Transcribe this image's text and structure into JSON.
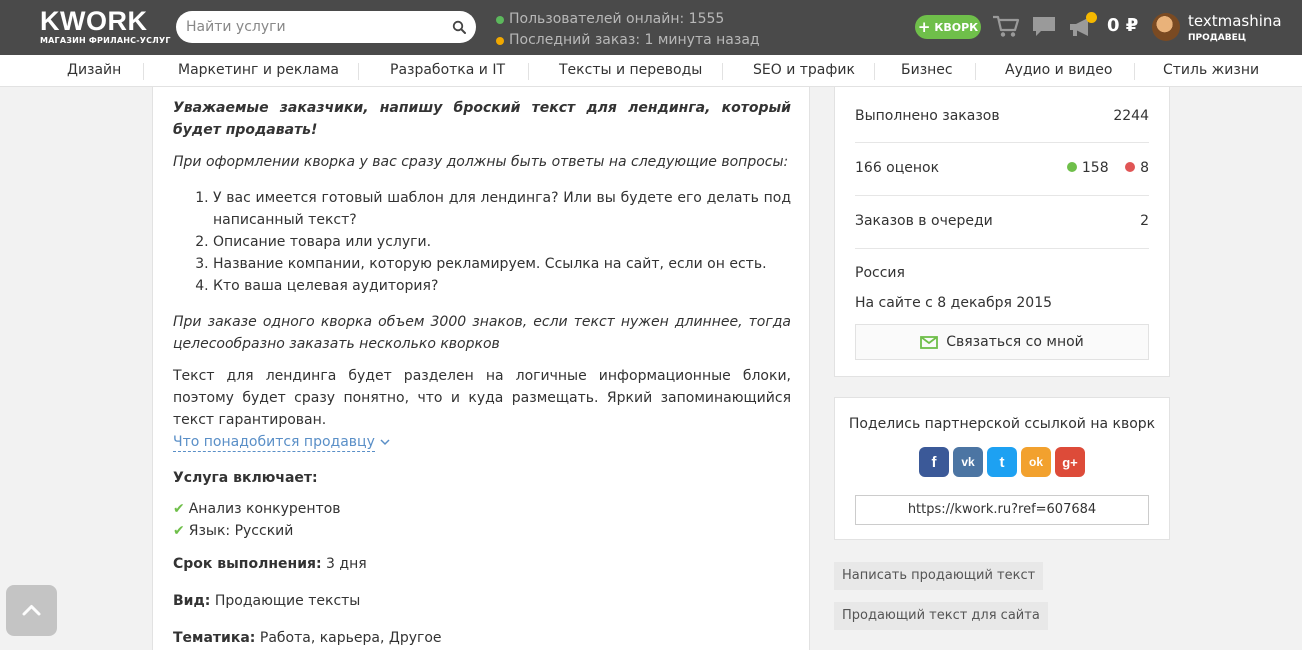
{
  "header": {
    "logo_text": "KWORK",
    "logo_sub": "МАГАЗИН ФРИЛАНС-УСЛУГ",
    "search_placeholder": "Найти услуги",
    "stats": {
      "online": "Пользователей онлайн: 1555",
      "last_order": "Последний заказ: 1 минута назад",
      "online_color": "#5cb85c",
      "last_order_color": "#f0a800"
    },
    "kwork_button": "КВОРК",
    "balance": "0 ₽",
    "user": {
      "name": "textmashina",
      "role": "ПРОДАВЕЦ"
    },
    "icons": [
      "cart-icon",
      "messages-icon",
      "notifications-icon"
    ]
  },
  "nav": {
    "items": [
      "Дизайн",
      "Маркетинг и реклама",
      "Разработка и IT",
      "Тексты и переводы",
      "SEO и трафик",
      "Бизнес",
      "Аудио и видео",
      "Стиль жизни"
    ]
  },
  "content": {
    "intro": "Уважаемые заказчики, напишу броский текст для лендинга, который будет продавать!",
    "questions_intro": "При оформлении кворка у вас сразу должны быть ответы на следующие вопросы:",
    "questions": [
      "У вас имеется готовый шаблон для лендинга? Или вы будете его делать под написанный текст?",
      "Описание товара или услуги.",
      "Название компании, которую рекламируем. Ссылка на сайт, если он есть.",
      "Кто ваша целевая аудитория?"
    ],
    "volume_note": "При заказе одного кворка объем 3000 знаков, если текст нужен длиннее, тогда целесообразно заказать несколько кворков",
    "description": "Текст для лендинга будет разделен на логичные информационные блоки, поэтому будет сразу понятно, что и куда размещать. Яркий запоминающийся текст гарантирован.",
    "seller_needs_link": "Что понадобится продавцу",
    "includes_title": "Услуга включает:",
    "includes": [
      "Анализ конкурентов",
      "Язык: Русский"
    ],
    "deadline_label": "Срок выполнения:",
    "deadline_value": "3 дня",
    "type_label": "Вид:",
    "type_value": "Продающие тексты",
    "topic_label": "Тематика:",
    "topic_value": "Работа, карьера, Другое"
  },
  "sidebar": {
    "completed_label": "Выполнено заказов",
    "completed_value": "2244",
    "ratings_label": "166 оценок",
    "ratings_positive": "158",
    "ratings_negative": "8",
    "queue_label": "Заказов в очереди",
    "queue_value": "2",
    "country": "Россия",
    "since": "На сайте с 8 декабря 2015",
    "contact_button": "Связаться со мной",
    "share_title": "Поделись партнерской ссылкой на кворк",
    "share_networks": [
      "facebook",
      "vkontakte",
      "twitter",
      "odnoklassniki",
      "google-plus"
    ],
    "share_labels": [
      "f",
      "vk",
      "t",
      "ok",
      "g+"
    ],
    "ref_link": "https://kwork.ru?ref=607684",
    "tags": [
      "Написать продающий текст",
      "Продающий текст для сайта"
    ]
  },
  "colors": {
    "header_bg": "#4a4a4a",
    "accent_green": "#6fbf4a",
    "link_blue": "#5a8fc7",
    "positive": "#6fbf4a",
    "negative": "#e05555"
  }
}
